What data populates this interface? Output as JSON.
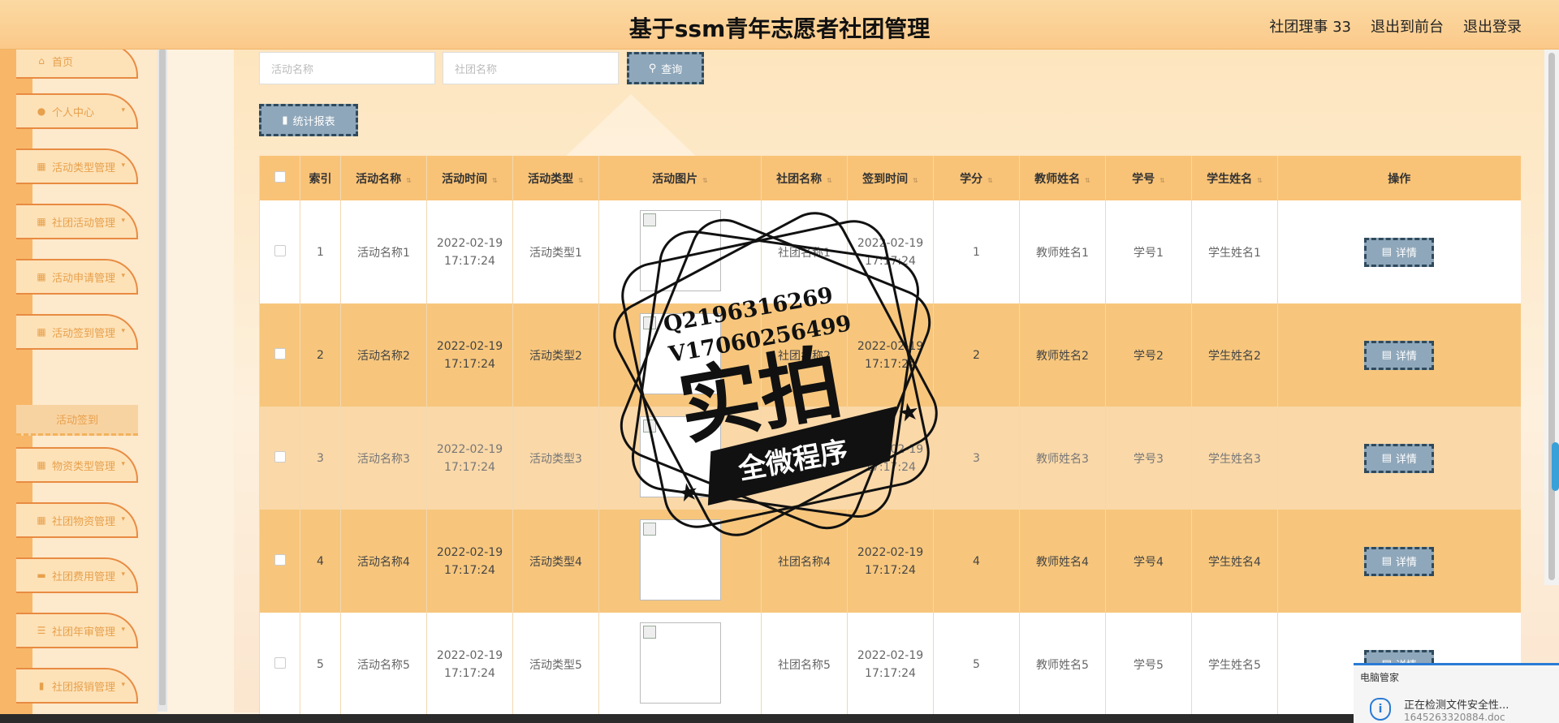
{
  "header": {
    "title": "基于ssm青年志愿者社团管理",
    "user": "社团理事 33",
    "to_front": "退出到前台",
    "logout": "退出登录"
  },
  "sidebar": {
    "items": [
      {
        "label": "首页",
        "icon": "home-icon"
      },
      {
        "label": "个人中心",
        "icon": "user-icon"
      },
      {
        "label": "活动类型管理",
        "icon": "grid-icon"
      },
      {
        "label": "社团活动管理",
        "icon": "grid-icon"
      },
      {
        "label": "活动申请管理",
        "icon": "grid-icon"
      },
      {
        "label": "活动签到管理",
        "icon": "grid-icon"
      },
      {
        "label": "物资类型管理",
        "icon": "grid-icon"
      },
      {
        "label": "社团物资管理",
        "icon": "grid-icon"
      },
      {
        "label": "社团费用管理",
        "icon": "chat-icon"
      },
      {
        "label": "社团年审管理",
        "icon": "sliders-icon"
      },
      {
        "label": "社团报销管理",
        "icon": "bar-icon"
      }
    ],
    "submenu_active": "活动签到"
  },
  "search": {
    "activity_placeholder": "活动名称",
    "club_placeholder": "社团名称",
    "query_label": "查询",
    "report_label": "统计报表"
  },
  "table": {
    "headers": [
      "索引",
      "活动名称",
      "活动时间",
      "活动类型",
      "活动图片",
      "社团名称",
      "签到时间",
      "学分",
      "教师姓名",
      "学号",
      "学生姓名",
      "操作"
    ],
    "detail_label": "详情",
    "rows": [
      {
        "index": "1",
        "name": "活动名称1",
        "date": "2022-02-19",
        "time": "17:17:24",
        "type": "活动类型1",
        "club": "社团名称1",
        "sign_date": "2022-02-19",
        "sign_time": "17:17:24",
        "credit": "1",
        "teacher": "教师姓名1",
        "sid": "学号1",
        "student": "学生姓名1"
      },
      {
        "index": "2",
        "name": "活动名称2",
        "date": "2022-02-19",
        "time": "17:17:24",
        "type": "活动类型2",
        "club": "社团名称2",
        "sign_date": "2022-02-19",
        "sign_time": "17:17:24",
        "credit": "2",
        "teacher": "教师姓名2",
        "sid": "学号2",
        "student": "学生姓名2"
      },
      {
        "index": "3",
        "name": "活动名称3",
        "date": "2022-02-19",
        "time": "17:17:24",
        "type": "活动类型3",
        "club": "社团名称3",
        "sign_date": "2022-02-19",
        "sign_time": "17:17:24",
        "credit": "3",
        "teacher": "教师姓名3",
        "sid": "学号3",
        "student": "学生姓名3"
      },
      {
        "index": "4",
        "name": "活动名称4",
        "date": "2022-02-19",
        "time": "17:17:24",
        "type": "活动类型4",
        "club": "社团名称4",
        "sign_date": "2022-02-19",
        "sign_time": "17:17:24",
        "credit": "4",
        "teacher": "教师姓名4",
        "sid": "学号4",
        "student": "学生姓名4"
      },
      {
        "index": "5",
        "name": "活动名称5",
        "date": "2022-02-19",
        "time": "17:17:24",
        "type": "活动类型5",
        "club": "社团名称5",
        "sign_date": "2022-02-19",
        "sign_time": "17:17:24",
        "credit": "5",
        "teacher": "教师姓名5",
        "sid": "学号5",
        "student": "学生姓名5"
      }
    ]
  },
  "watermark": {
    "line1": "Q2196316269",
    "line2": "V17060256499",
    "big": "实拍",
    "banner": "全微程序"
  },
  "notification": {
    "title": "电脑管家",
    "message": "正在检测文件安全性...",
    "file": "1645263320884.doc"
  },
  "colors": {
    "header": "#fbc98a",
    "accent": "#f9c377",
    "button": "#8fa7ba"
  }
}
